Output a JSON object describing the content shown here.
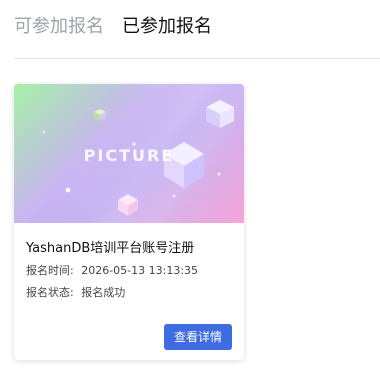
{
  "tabs": [
    {
      "label": "可参加报名",
      "active": false
    },
    {
      "label": "已参加报名",
      "active": true
    }
  ],
  "card": {
    "image_text": "PICTURE",
    "title": "YashanDB培训平台账号注册",
    "time_label": "报名时间:",
    "time_value": "2026-05-13 13:13:35",
    "status_label": "报名状态:",
    "status_value": "报名成功",
    "button_label": "查看详情",
    "colors": {
      "button": "#3f6ce0",
      "thumb_start": "#a7f0a7",
      "thumb_mid": "#b9a3f0",
      "thumb_end": "#f7a6d8"
    }
  }
}
